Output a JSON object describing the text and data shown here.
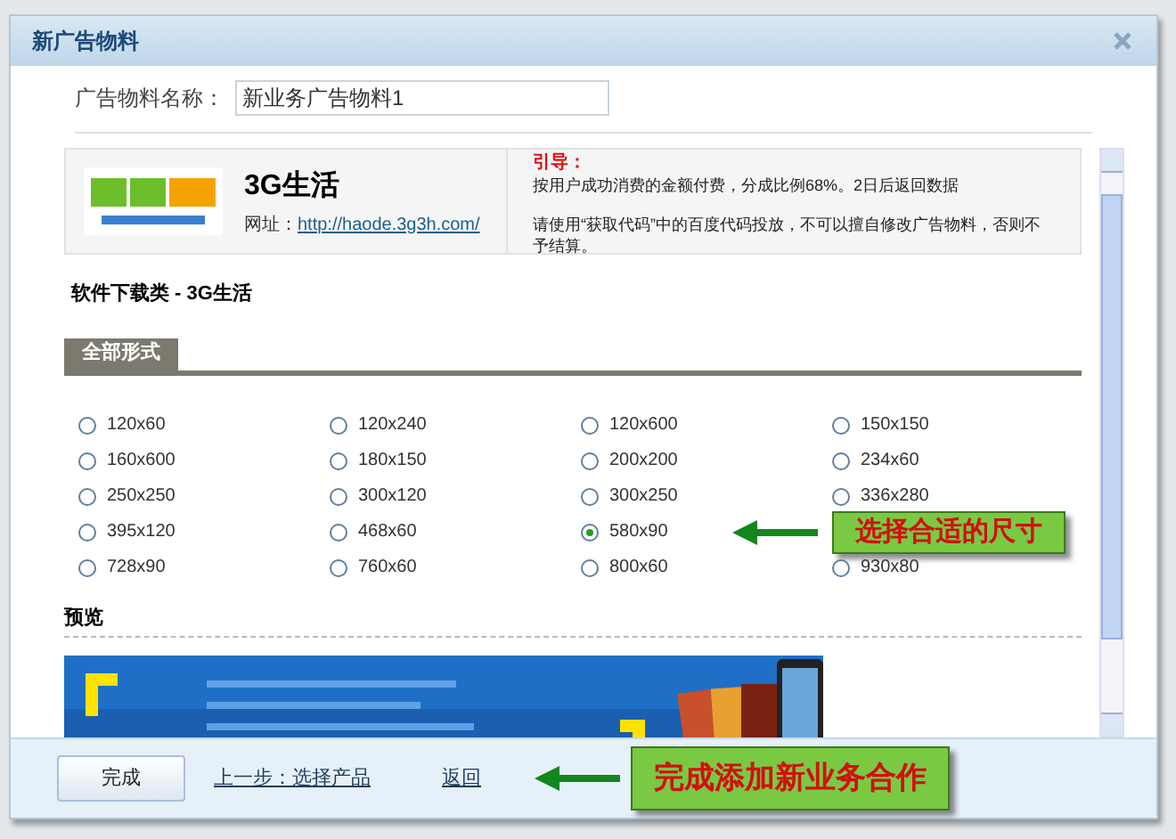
{
  "window": {
    "title": "新广告物料"
  },
  "name_field": {
    "label": "广告物料名称：",
    "value": "新业务广告物料1"
  },
  "product": {
    "name": "3G生活",
    "url_label": "网址：",
    "url": "http://haode.3g3h.com/",
    "guide_title": "引导：",
    "guide_lines": [
      "按用户成功消费的金额付费，分成比例68%。2日后返回数据",
      "请使用“获取代码”中的百度代码投放，不可以擅自修改广告物料，否则不予结算。"
    ]
  },
  "category": "软件下载类 - 3G生活",
  "tabs": [
    {
      "label": "全部形式",
      "selected": true
    }
  ],
  "sizes": [
    {
      "label": "120x60",
      "selected": false
    },
    {
      "label": "120x240",
      "selected": false
    },
    {
      "label": "120x600",
      "selected": false
    },
    {
      "label": "150x150",
      "selected": false
    },
    {
      "label": "160x600",
      "selected": false
    },
    {
      "label": "180x150",
      "selected": false
    },
    {
      "label": "200x200",
      "selected": false
    },
    {
      "label": "234x60",
      "selected": false
    },
    {
      "label": "250x250",
      "selected": false
    },
    {
      "label": "300x120",
      "selected": false
    },
    {
      "label": "300x250",
      "selected": false
    },
    {
      "label": "336x280",
      "selected": false
    },
    {
      "label": "395x120",
      "selected": false
    },
    {
      "label": "468x60",
      "selected": false
    },
    {
      "label": "580x90",
      "selected": true
    },
    {
      "kind": "callout",
      "text": "选择合适的尺寸"
    },
    {
      "label": "728x90",
      "selected": false
    },
    {
      "label": "760x60",
      "selected": false
    },
    {
      "label": "800x60",
      "selected": false
    },
    {
      "label": "930x80",
      "selected": false
    }
  ],
  "preview": {
    "title": "预览"
  },
  "footer": {
    "done": "完成",
    "back_step": "上一步：选择产品",
    "return": "返回",
    "callout": "完成添加新业务合作"
  }
}
